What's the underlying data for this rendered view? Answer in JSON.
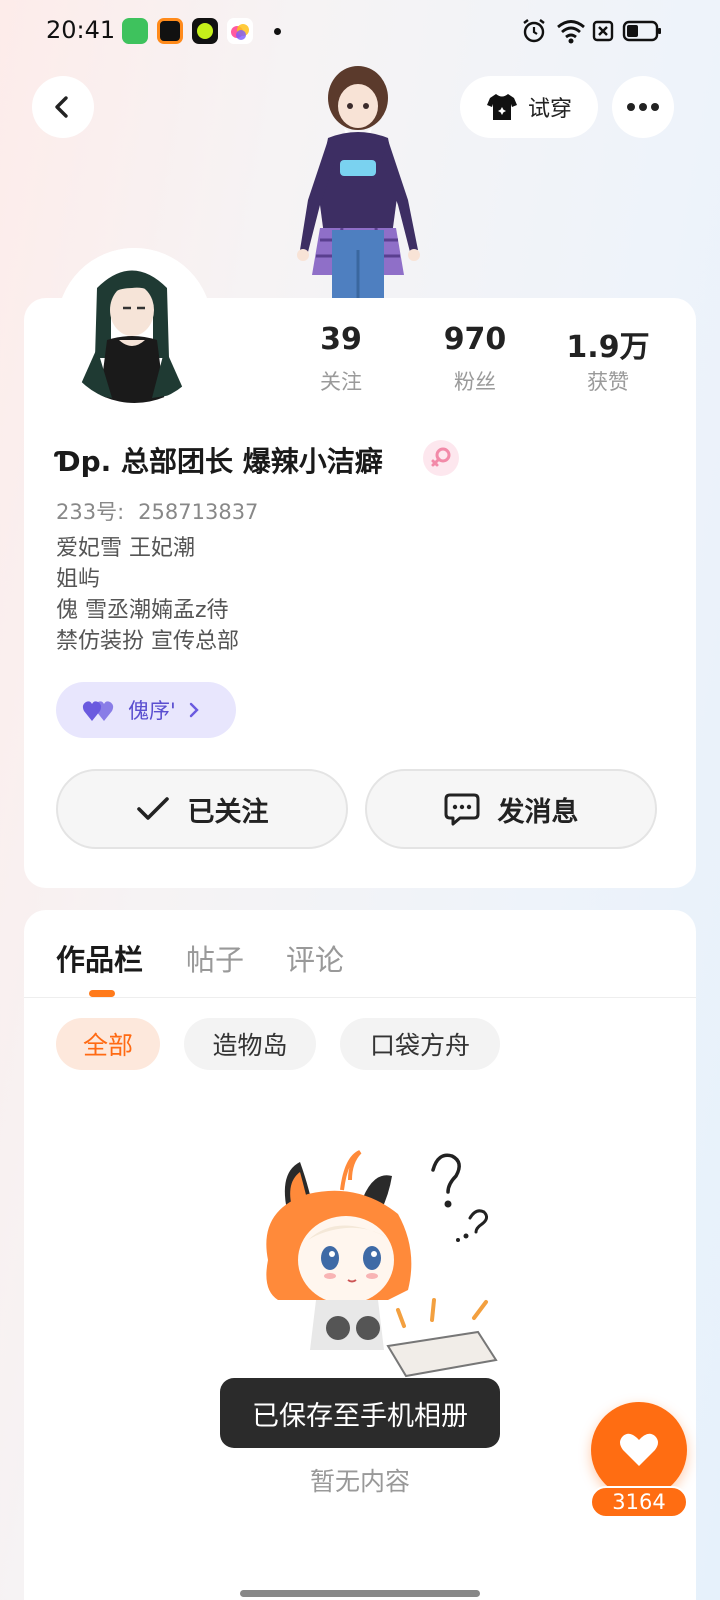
{
  "status_bar": {
    "time": "20:41",
    "apps": [
      "app-icon-green",
      "app-icon-orange",
      "app-icon-lime",
      "app-icon-colorful"
    ],
    "right_icons": [
      "alarm-icon",
      "wifi-icon",
      "sim-off-icon",
      "battery-icon"
    ]
  },
  "header": {
    "back_icon": "back-arrow-icon",
    "tryon_label": "试穿",
    "more_icon": "more-icon"
  },
  "profile": {
    "stats": [
      {
        "value": "39",
        "label": "关注"
      },
      {
        "value": "970",
        "label": "粉丝"
      },
      {
        "value": "1.9万",
        "label": "获赞"
      }
    ],
    "nickname": "Ɗp. 总部团长 爆辣小洁癖",
    "gender": "female",
    "uid_label": "233号:",
    "uid": "258713837",
    "bio_lines": [
      "爱妃雪 王妃潮",
      "姐屿",
      "傀 雪丞潮婻孟z待",
      "禁仿装扮 宣传总部"
    ],
    "group_chip_label": "傀序'",
    "follow_button": "已关注",
    "message_button": "发消息"
  },
  "tabs": [
    {
      "label": "作品栏",
      "active": true
    },
    {
      "label": "帖子",
      "active": false
    },
    {
      "label": "评论",
      "active": false
    }
  ],
  "filters": [
    {
      "label": "全部",
      "active": true
    },
    {
      "label": "造物岛",
      "active": false
    },
    {
      "label": "口袋方舟",
      "active": false
    }
  ],
  "empty_state": "暂无内容",
  "toast": "已保存至手机相册",
  "like": {
    "count": "3164"
  },
  "colors": {
    "accent": "#ff6d12",
    "chip_active_bg": "#fde8dc",
    "group_chip_bg": "#e8e6fd",
    "group_chip_text": "#5b4fd0",
    "gender_pink": "#f28aa8"
  }
}
